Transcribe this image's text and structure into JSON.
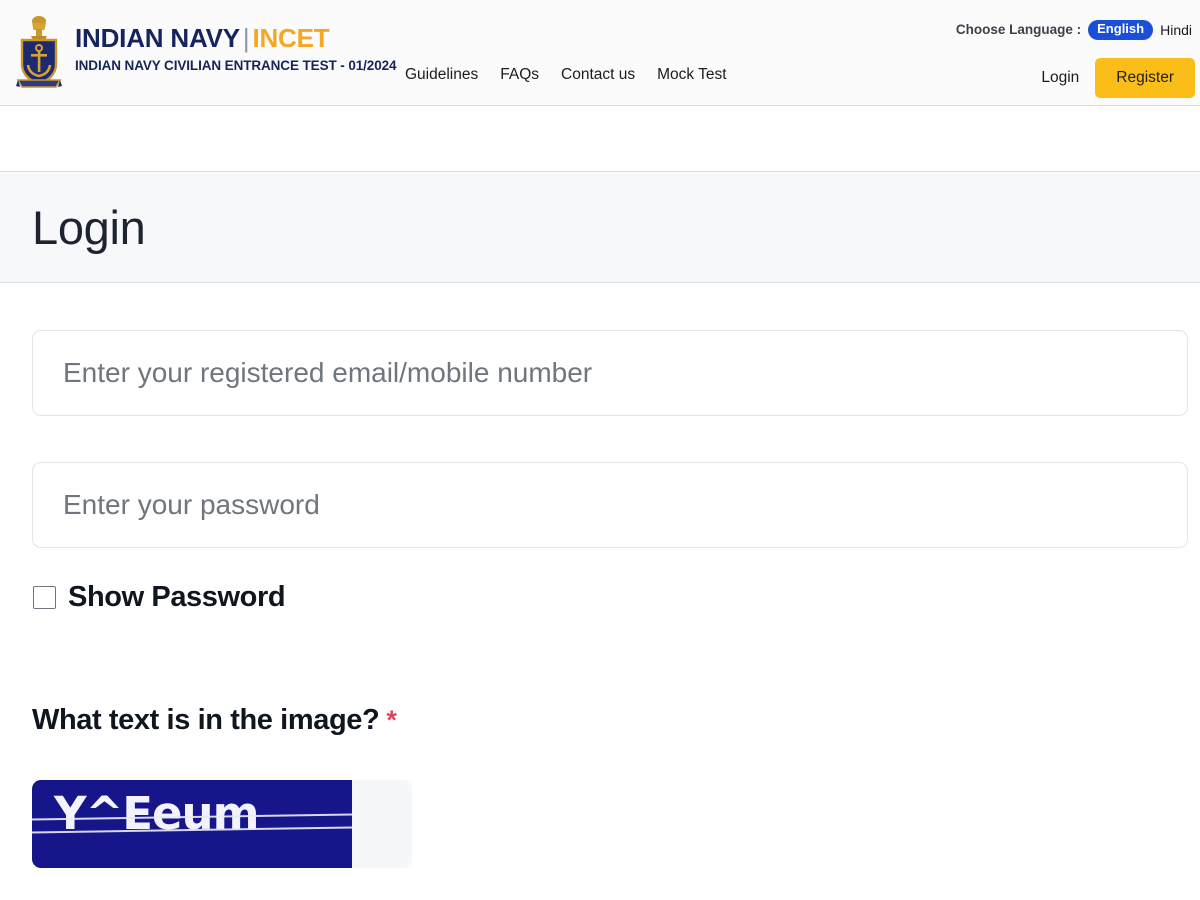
{
  "header": {
    "brand": {
      "logo_icon": "indian-navy-crest-icon",
      "title_primary": "INDIAN NAVY",
      "title_separator": "|",
      "title_secondary": "INCET",
      "subtitle": "INDIAN NAVY CIVILIAN ENTRANCE TEST - 01/2024",
      "color_navy": "#16245c",
      "color_incet": "#f5a623"
    },
    "nav": [
      {
        "label": "Guidelines"
      },
      {
        "label": "FAQs"
      },
      {
        "label": "Contact us"
      },
      {
        "label": "Mock Test"
      }
    ],
    "language": {
      "label": "Choose Language :",
      "selected": "English",
      "alternate": "Hindi",
      "pill_color": "#1b4fd8"
    },
    "auth": {
      "login_label": "Login",
      "register_label": "Register",
      "register_color": "#fbbe18"
    }
  },
  "page": {
    "title": "Login"
  },
  "form": {
    "email": {
      "placeholder": "Enter your registered email/mobile number",
      "value": ""
    },
    "password": {
      "placeholder": "Enter your password",
      "value": ""
    },
    "show_password": {
      "label": "Show Password",
      "checked": false
    },
    "captcha": {
      "question": "What text is in the image?",
      "required_marker": "*",
      "required_color": "#e0455f",
      "image_text": "Y^Eeum",
      "image_bg_color": "#16168a",
      "image_text_color": "#f3f3ff"
    }
  }
}
